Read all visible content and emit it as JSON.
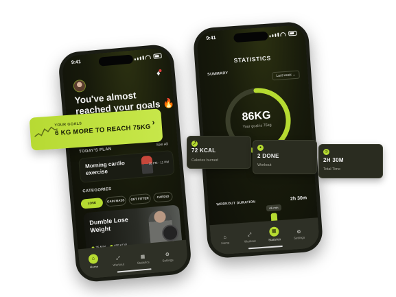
{
  "left_phone": {
    "status_time": "9:41",
    "headline": "You've almost reached your goals",
    "headline_emoji": "🔥",
    "plan_section": "TODAY'S PLAN",
    "see_all": "See All",
    "plan": {
      "title": "Morning cardio exercise",
      "time": "10 PM - 11 PM"
    },
    "categories_section": "CATEGORIES",
    "chips": [
      "LOSE WEIGHT",
      "GAIN MASS",
      "GET FITTER",
      "CARDIO"
    ],
    "feature": {
      "title": "Dumble Lose Weight",
      "duration": "25 MIN",
      "calories": "450 KCAL"
    },
    "tabs": [
      {
        "label": "Home",
        "icon": "home-icon"
      },
      {
        "label": "Workout",
        "icon": "workout-icon"
      },
      {
        "label": "Statistics",
        "icon": "stats-icon"
      },
      {
        "label": "Settings",
        "icon": "settings-icon"
      }
    ]
  },
  "goal_banner": {
    "label": "YOUR GOALS",
    "text": "6 KG MORE TO REACH 75KG"
  },
  "right_phone": {
    "status_time": "9:41",
    "title": "STATISTICS",
    "summary_label": "SUMMARY",
    "period": "Last week",
    "ring": {
      "value": "86KG",
      "subtitle": "Your goal is 75kg",
      "progress": 0.55
    },
    "duration_label": "WORKOUT DURATION",
    "duration_total": "2h 30m",
    "duration_bars": [
      0.45,
      0.72,
      0.5,
      0.62,
      0.95,
      0.45,
      0.72
    ],
    "highlight_index": 4,
    "highlight_tip": "46 min",
    "tabs": [
      {
        "label": "Home",
        "icon": "home-icon"
      },
      {
        "label": "Workout",
        "icon": "workout-icon"
      },
      {
        "label": "Statistics",
        "icon": "stats-icon"
      },
      {
        "label": "Settings",
        "icon": "settings-icon"
      }
    ]
  },
  "stat_cards": [
    {
      "value": "72 KCAL",
      "caption": "Calories burned"
    },
    {
      "value": "2 DONE",
      "caption": "Workout"
    },
    {
      "value": "2H 30M",
      "caption": "Total Time"
    }
  ],
  "colors": {
    "accent": "#b6db31",
    "background_dark": "#0f0f0c",
    "card": "#2a2c20"
  }
}
